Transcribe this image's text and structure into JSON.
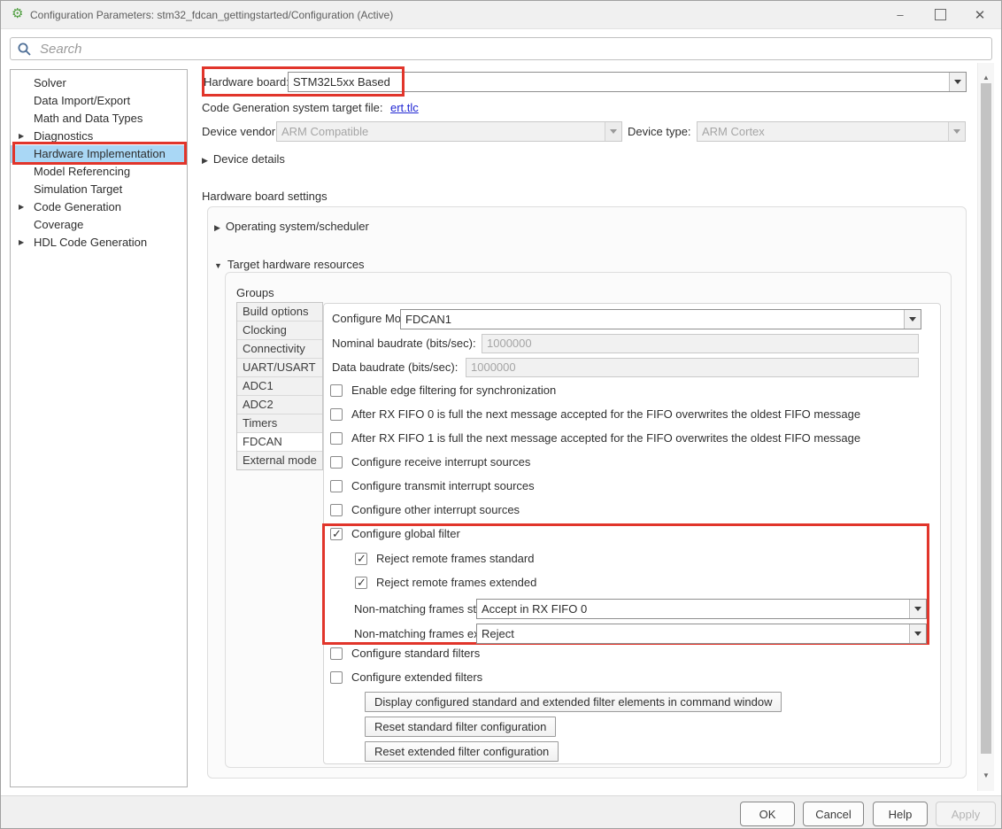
{
  "colors": {
    "accent_red": "#e1352b",
    "selection_blue": "#a9d7f5",
    "link_blue": "#2127d3"
  },
  "window": {
    "title": "Configuration Parameters: stm32_fdcan_gettingstarted/Configuration (Active)"
  },
  "search": {
    "placeholder": "Search"
  },
  "sidebar": {
    "items": [
      {
        "label": "Solver",
        "expandable": false,
        "selected": false
      },
      {
        "label": "Data Import/Export",
        "expandable": false,
        "selected": false
      },
      {
        "label": "Math and Data Types",
        "expandable": false,
        "selected": false
      },
      {
        "label": "Diagnostics",
        "expandable": true,
        "selected": false
      },
      {
        "label": "Hardware Implementation",
        "expandable": false,
        "selected": true
      },
      {
        "label": "Model Referencing",
        "expandable": false,
        "selected": false
      },
      {
        "label": "Simulation Target",
        "expandable": false,
        "selected": false
      },
      {
        "label": "Code Generation",
        "expandable": true,
        "selected": false
      },
      {
        "label": "Coverage",
        "expandable": false,
        "selected": false
      },
      {
        "label": "HDL Code Generation",
        "expandable": true,
        "selected": false
      }
    ]
  },
  "header": {
    "hardware_board_label": "Hardware board:",
    "hardware_board_value": "STM32L5xx Based",
    "target_file_label": "Code Generation system target file:",
    "target_file_link": "ert.tlc",
    "device_vendor_label": "Device vendor:",
    "device_vendor_value": "ARM Compatible",
    "device_type_label": "Device type:",
    "device_type_value": "ARM Cortex",
    "device_details_label": "Device details"
  },
  "board": {
    "title": "Hardware board settings",
    "os_scheduler_label": "Operating system/scheduler",
    "target_resources_label": "Target hardware resources",
    "groups_label": "Groups",
    "groups": [
      {
        "label": "Build options",
        "selected": false
      },
      {
        "label": "Clocking",
        "selected": false
      },
      {
        "label": "Connectivity",
        "selected": false
      },
      {
        "label": "UART/USART",
        "selected": false
      },
      {
        "label": "ADC1",
        "selected": false
      },
      {
        "label": "ADC2",
        "selected": false
      },
      {
        "label": "Timers",
        "selected": false
      },
      {
        "label": "FDCAN",
        "selected": true
      },
      {
        "label": "External mode",
        "selected": false
      }
    ]
  },
  "fdcan": {
    "configure_module_label": "Configure Module:",
    "configure_module_value": "FDCAN1",
    "nominal_baudrate_label": "Nominal baudrate (bits/sec):",
    "nominal_baudrate_value": "1000000",
    "data_baudrate_label": "Data baudrate (bits/sec):",
    "data_baudrate_value": "1000000",
    "options": [
      {
        "label": "Enable edge filtering for synchronization",
        "checked": false
      },
      {
        "label": "After RX FIFO 0 is full the next message accepted for the FIFO overwrites the oldest FIFO message",
        "checked": false
      },
      {
        "label": "After RX FIFO 1 is full the next message accepted for the FIFO overwrites the oldest FIFO message",
        "checked": false
      },
      {
        "label": "Configure receive interrupt sources",
        "checked": false
      },
      {
        "label": "Configure transmit interrupt sources",
        "checked": false
      },
      {
        "label": "Configure other interrupt sources",
        "checked": false
      }
    ],
    "global_filter": {
      "label": "Configure global filter",
      "checked": true,
      "reject_standard_label": "Reject remote frames standard",
      "reject_standard_checked": true,
      "reject_extended_label": "Reject remote frames extended",
      "reject_extended_checked": true,
      "nonmatching_standard_label": "Non-matching frames standard:",
      "nonmatching_standard_value": "Accept in RX FIFO 0",
      "nonmatching_extended_label": "Non-matching frames extended:",
      "nonmatching_extended_value": "Reject"
    },
    "standard_filters_label": "Configure standard filters",
    "extended_filters_label": "Configure extended filters",
    "buttons": [
      {
        "label": "Display configured standard and extended filter elements in command window"
      },
      {
        "label": "Reset standard filter configuration"
      },
      {
        "label": "Reset extended filter configuration"
      }
    ]
  },
  "footer": {
    "buttons": [
      {
        "label": "OK",
        "disabled": false
      },
      {
        "label": "Cancel",
        "disabled": false
      },
      {
        "label": "Help",
        "disabled": false
      },
      {
        "label": "Apply",
        "disabled": true
      }
    ]
  }
}
